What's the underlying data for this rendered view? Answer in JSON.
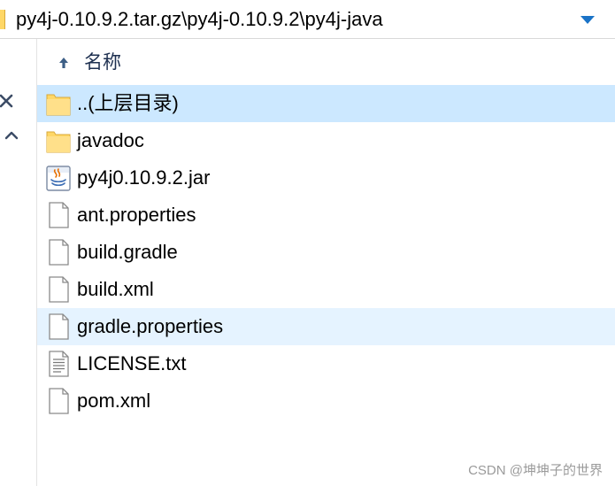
{
  "address_bar": {
    "path": "py4j-0.10.9.2.tar.gz\\py4j-0.10.9.2\\py4j-java"
  },
  "column_header": {
    "name_label": "名称"
  },
  "files": [
    {
      "name": "..(上层目录)",
      "icon": "folder-icon",
      "state": "selected"
    },
    {
      "name": "javadoc",
      "icon": "folder-icon",
      "state": "normal"
    },
    {
      "name": "py4j0.10.9.2.jar",
      "icon": "java-jar-icon",
      "state": "normal"
    },
    {
      "name": "ant.properties",
      "icon": "file-icon",
      "state": "normal"
    },
    {
      "name": "build.gradle",
      "icon": "file-icon",
      "state": "normal"
    },
    {
      "name": "build.xml",
      "icon": "file-icon",
      "state": "normal"
    },
    {
      "name": "gradle.properties",
      "icon": "file-icon",
      "state": "hover"
    },
    {
      "name": "LICENSE.txt",
      "icon": "text-file-icon",
      "state": "normal"
    },
    {
      "name": "pom.xml",
      "icon": "file-icon",
      "state": "normal"
    }
  ],
  "watermark": "CSDN @坤坤子的世界",
  "colors": {
    "selected_row": "#cce8ff",
    "hover_row": "#e5f3ff",
    "folder": "#ffd766",
    "accent": "#1a73c7"
  }
}
